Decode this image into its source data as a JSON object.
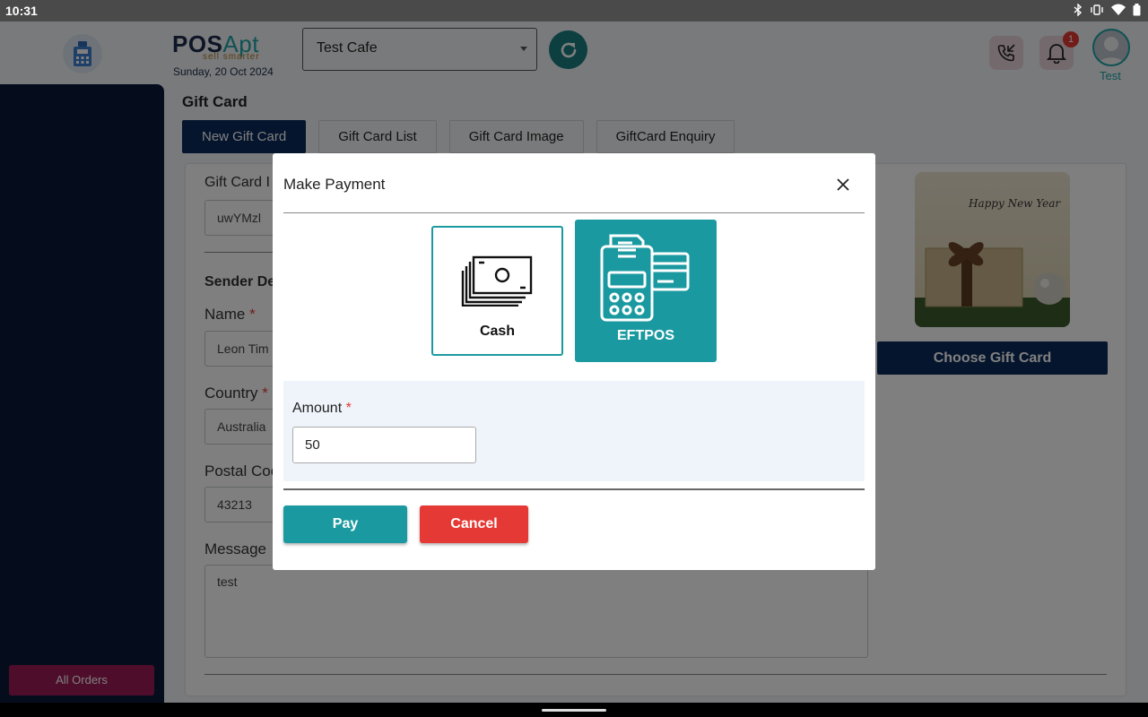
{
  "status_bar": {
    "time": "10:31"
  },
  "header": {
    "logo_pos": "POS",
    "logo_apt": "Apt",
    "logo_tagline": "sell smarter",
    "date": "Sunday, 20 Oct 2024",
    "store_name": "Test Cafe",
    "notification_count": "1",
    "user_name": "Test"
  },
  "sidebar": {
    "all_orders_label": "All Orders"
  },
  "page": {
    "title": "Gift Card",
    "tabs": [
      {
        "label": "New Gift Card",
        "active": true
      },
      {
        "label": "Gift Card List",
        "active": false
      },
      {
        "label": "Gift Card Image",
        "active": false
      },
      {
        "label": "GiftCard Enquiry",
        "active": false
      }
    ]
  },
  "form": {
    "gift_card_label": "Gift Card I",
    "gift_card_value": "uwYMzl",
    "sender_details_label": "Sender De",
    "name_label": "Name",
    "name_value": "Leon Tim",
    "country_label": "Country",
    "country_value": "Australia",
    "postal_code_label": "Postal Coc",
    "postal_code_value": "43213",
    "message_label": "Message",
    "message_value": "test",
    "required_mark": "*"
  },
  "gift_image": {
    "caption": "Happy New Year",
    "choose_label": "Choose Gift Card"
  },
  "modal": {
    "title": "Make Payment",
    "options": [
      {
        "label": "Cash",
        "selected": false
      },
      {
        "label": "EFTPOS",
        "selected": true
      }
    ],
    "amount_label": "Amount",
    "amount_value": "50",
    "pay_label": "Pay",
    "cancel_label": "Cancel"
  },
  "colors": {
    "primary_navy": "#0b2a5b",
    "teal": "#1a9aa0",
    "danger": "#e53935",
    "sidebar": "#0b1a3a",
    "all_orders": "#9c1c57"
  },
  "icons": [
    "bluetooth-icon",
    "vibrate-icon",
    "wifi-icon",
    "battery-icon",
    "pos-terminal-icon",
    "refresh-icon",
    "phone-call-icon",
    "bell-icon",
    "user-avatar-icon",
    "close-icon",
    "cash-icon",
    "eftpos-icon"
  ]
}
